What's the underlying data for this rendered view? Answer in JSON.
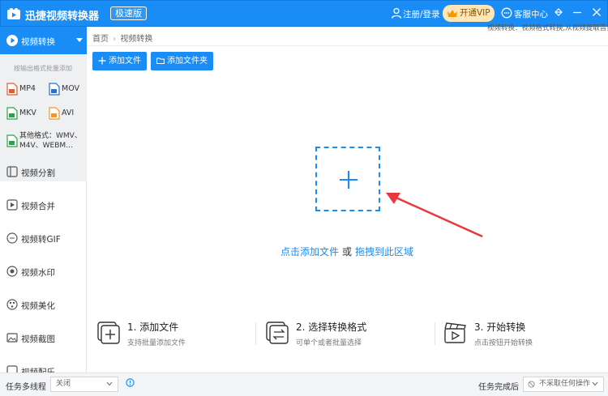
{
  "titlebar": {
    "app_title": "迅捷视频转换器",
    "badge": "极速版",
    "login": "注册/登录",
    "vip": "开通VIP",
    "service": "客服中心"
  },
  "sidebar": {
    "active": "视频转换",
    "batch_hint": "按输出格式批量添加",
    "formats": [
      {
        "label": "MP4",
        "icon": "mp4-file-icon"
      },
      {
        "label": "MOV",
        "icon": "mov-file-icon"
      },
      {
        "label": "MKV",
        "icon": "mkv-file-icon"
      },
      {
        "label": "AVI",
        "icon": "avi-file-icon"
      }
    ],
    "other_formats": "其他格式：WMV、M4V、WEBM…",
    "items": [
      {
        "label": "视频分割",
        "icon": "split-icon"
      },
      {
        "label": "视频合并",
        "icon": "merge-icon"
      },
      {
        "label": "视频转GIF",
        "icon": "gif-icon"
      },
      {
        "label": "视频水印",
        "icon": "watermark-icon"
      },
      {
        "label": "视频美化",
        "icon": "beautify-icon"
      },
      {
        "label": "视频截图",
        "icon": "screenshot-icon"
      },
      {
        "label": "视频配乐",
        "icon": "music-icon"
      }
    ]
  },
  "breadcrumb": {
    "home": "首页",
    "sep": "›",
    "current": "视频转换"
  },
  "description": "视频转换：视频格式转换,从视频提取音频",
  "toolbar": {
    "add_file": "添加文件",
    "add_folder": "添加文件夹"
  },
  "dropzone": {
    "hint_link1": "点击添加文件",
    "hint_or": "或",
    "hint_link2": "拖拽到此区域"
  },
  "steps": [
    {
      "title": "1. 添加文件",
      "desc": "支持批量添加文件"
    },
    {
      "title": "2. 选择转换格式",
      "desc": "可单个或者批量选择"
    },
    {
      "title": "3. 开始转换",
      "desc": "点击按钮开始转换"
    }
  ],
  "bottom": {
    "multithread_label": "任务多线程",
    "multithread_value": "关闭",
    "after_label": "任务完成后",
    "after_value": "不采取任何操作"
  },
  "colors": {
    "accent": "#1a8cf5",
    "arrow": "#e8383d",
    "vip": "#fde6b7"
  }
}
